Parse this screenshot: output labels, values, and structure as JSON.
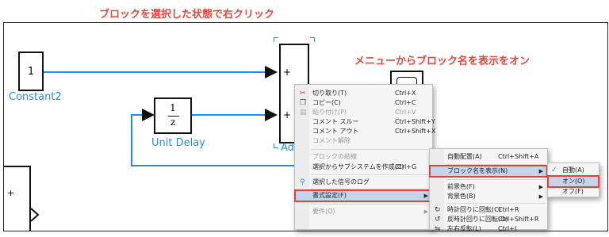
{
  "annotations": {
    "top": "ブロックを選択した状態で右クリック",
    "right": "メニューからブロック名を表示をオン"
  },
  "blocks": {
    "constant": {
      "value": "1",
      "label": "Constant2"
    },
    "unit_delay": {
      "numerator": "1",
      "denominator": "z",
      "label": "Unit Delay"
    },
    "add": {
      "label": "Add",
      "port1": "+",
      "port2": "+"
    },
    "left_block_port": "+"
  },
  "context_menu": {
    "items": [
      {
        "label": "切り取り(T)",
        "shortcut": "Ctrl+X",
        "enabled": true,
        "icon": "cut-icon"
      },
      {
        "label": "コピー(C)",
        "shortcut": "Ctrl+C",
        "enabled": true,
        "icon": "copy-icon"
      },
      {
        "label": "貼り付け(P)",
        "shortcut": "Ctrl+V",
        "enabled": false,
        "icon": "paste-icon"
      },
      {
        "label": "コメント スルー",
        "shortcut": "Ctrl+Shift+Y",
        "enabled": true
      },
      {
        "label": "コメント アウト",
        "shortcut": "Ctrl+Shift+X",
        "enabled": true
      },
      {
        "label": "コメント解除",
        "shortcut": "",
        "enabled": false
      },
      {
        "label": "ブロックの結線",
        "shortcut": "",
        "enabled": false
      },
      {
        "label": "選択からサブシステムを作成(C)",
        "shortcut": "Ctrl+G",
        "enabled": true
      },
      {
        "label": "選択した信号のログ",
        "shortcut": "",
        "enabled": true,
        "icon": "signal-log-icon"
      },
      {
        "label": "書式設定(F)",
        "shortcut": "",
        "enabled": true,
        "submenu": true,
        "highlighted": true
      },
      {
        "label": "要件(Q)",
        "shortcut": "",
        "enabled": false,
        "submenu": true
      }
    ]
  },
  "format_submenu": {
    "items": [
      {
        "label": "自動配置(A)",
        "shortcut": "Ctrl+Shift+A"
      },
      {
        "label": "ブロック名を表示(N)",
        "shortcut": "",
        "submenu": true,
        "highlighted": true
      },
      {
        "label": "前景色(F)",
        "shortcut": "",
        "submenu": true
      },
      {
        "label": "背景色(B)",
        "shortcut": "",
        "submenu": true
      },
      {
        "label": "時計回りに回転(C)",
        "shortcut": "Ctrl+R",
        "icon": "rotate-cw-icon"
      },
      {
        "label": "反時計回りに回転(O)",
        "shortcut": "Ctrl+Shift+R",
        "icon": "rotate-ccw-icon"
      },
      {
        "label": "左右反転(L)",
        "shortcut": "Ctrl+I",
        "icon": "flip-icon"
      }
    ]
  },
  "name_submenu": {
    "items": [
      {
        "label": "自動(A)",
        "checked": true
      },
      {
        "label": "オン(O)",
        "highlighted": true
      },
      {
        "label": "オフ(F)"
      }
    ]
  },
  "colors": {
    "signal": "#1d8ff0",
    "highlight": "#e5403a",
    "annotation": "#e8473d"
  }
}
